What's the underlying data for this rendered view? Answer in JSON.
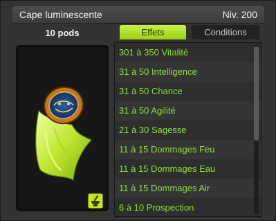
{
  "header": {
    "title": "Cape luminescente",
    "level": "Niv. 200"
  },
  "weight": "10 pods",
  "tabs": {
    "effects": "Effets",
    "conditions": "Conditions"
  },
  "effects": [
    "301 à 350 Vitalité",
    "31 à 50 Intelligence",
    "31 à 50 Chance",
    "31 à 50 Agilité",
    "21 à 30 Sagesse",
    "11 à 15 Dommages Feu",
    "11 à 15 Dommages Eau",
    "11 à 15 Dommages Air",
    "6 à 10 Prospection"
  ],
  "icons": {
    "recipe": "mortar-pestle-icon",
    "item": "cape-icon"
  },
  "colors": {
    "accent": "#9ad014",
    "effect_text": "#8fde3a"
  }
}
